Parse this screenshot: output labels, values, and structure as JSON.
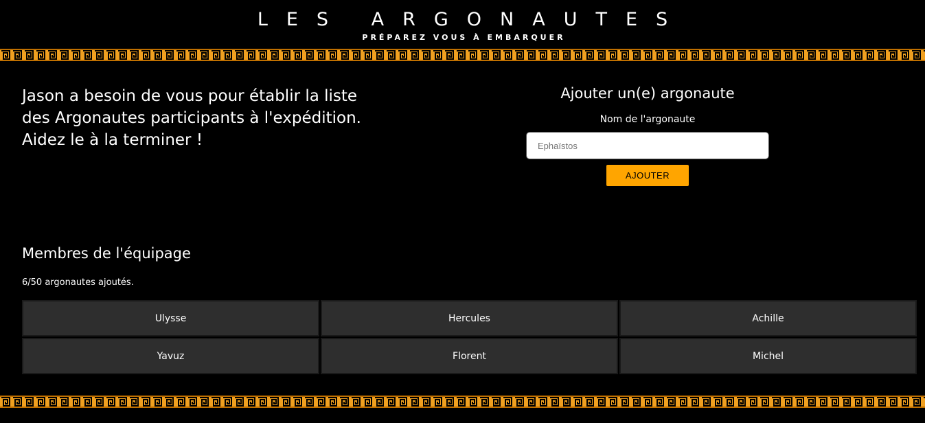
{
  "header": {
    "title": "LES ARGONAUTES",
    "subtitle": "PRÉPAREZ VOUS À EMBARQUER"
  },
  "intro": {
    "text": "Jason a besoin de vous pour établir la liste des Argonautes participants à l'expédition. Aidez le à la terminer !"
  },
  "add_form": {
    "title": "Ajouter un(e) argonaute",
    "label": "Nom de l'argonaute",
    "placeholder": "Ephaïstos",
    "button_label": "AJOUTER"
  },
  "crew": {
    "title": "Membres de l'équipage",
    "count_text": "6/50 argonautes ajoutés.",
    "members": [
      "Ulysse",
      "Hercules",
      "Achille",
      "Yavuz",
      "Florent",
      "Michel"
    ]
  },
  "colors": {
    "background": "#000000",
    "accent": "#ffa500",
    "greek_key_border": "#f0a020",
    "cell_background": "#2e2e2e"
  },
  "icons": {
    "border_pattern": "greek-key-pattern"
  }
}
